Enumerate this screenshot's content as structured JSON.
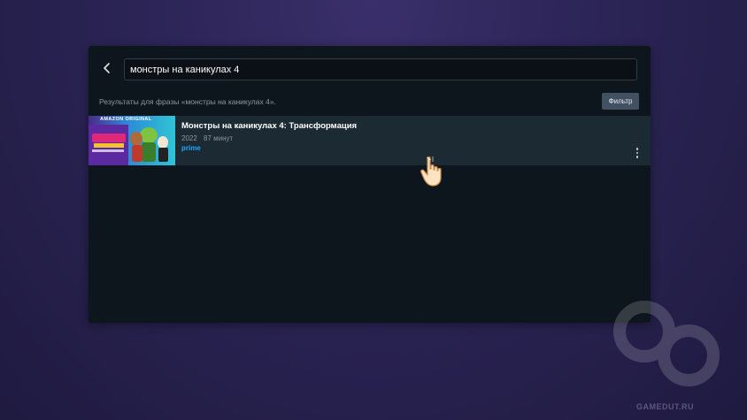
{
  "search": {
    "query": "монстры на каникулах 4"
  },
  "results": {
    "label": "Результаты для фразы «монстры на каникулах 4».",
    "filter_label": "Фильтр",
    "items": [
      {
        "badge": "AMAZON ORIGINAL",
        "title": "Монстры на каникулах 4: Трансформация",
        "year": "2022",
        "duration": "87 минут",
        "service": "prime"
      }
    ]
  },
  "watermark": {
    "text": "GAMEDUT.RU"
  },
  "colors": {
    "background": "#2b2455",
    "panel": "#0e161d",
    "row_highlight": "#1b2a33",
    "prime_accent": "#1ea7ff",
    "filter_button": "#425162"
  },
  "icons": [
    "chevron-left-icon",
    "more-vertical-icon",
    "hand-pointer-icon",
    "gamedut-logo-icon"
  ]
}
